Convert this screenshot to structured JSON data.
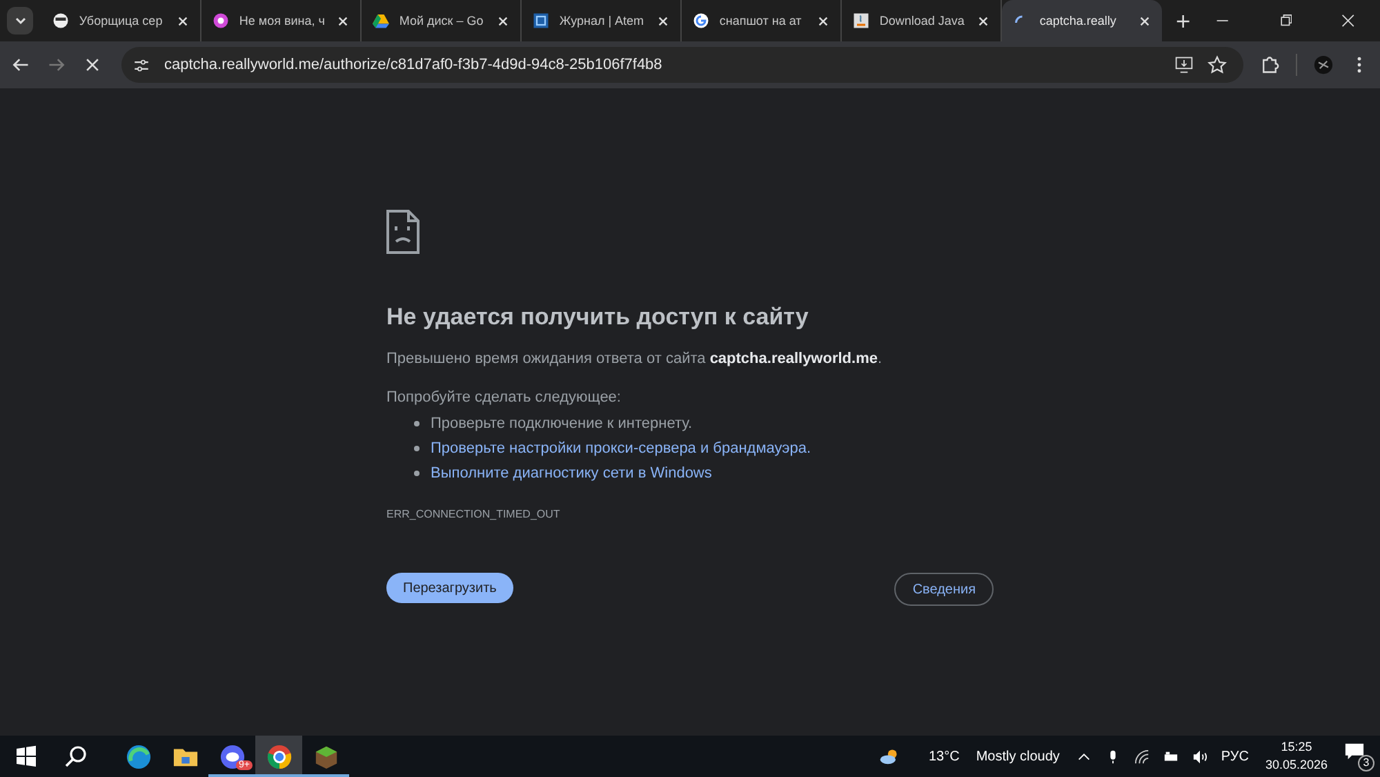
{
  "tabs": [
    {
      "title": "Уборщица сер",
      "kind": "face",
      "selected": false
    },
    {
      "title": "Не моя вина, ч",
      "kind": "flower",
      "selected": false
    },
    {
      "title": "Мой диск – Go",
      "kind": "drive",
      "selected": false
    },
    {
      "title": "Журнал | Atem",
      "kind": "square",
      "selected": false
    },
    {
      "title": "снапшот на ат",
      "kind": "google",
      "selected": false
    },
    {
      "title": "Download Java",
      "kind": "java",
      "selected": false
    },
    {
      "title": "captcha.really",
      "kind": "loading",
      "selected": true
    }
  ],
  "address_bar": {
    "url": "captcha.reallyworld.me/authorize/c81d7af0-f3b7-4d9d-94c8-25b106f7f4b8"
  },
  "error_page": {
    "heading": "Не удается получить доступ к сайту",
    "message": "Превышено время ожидания ответа от сайта **captcha.reallyworld.me**.",
    "suggestions_title": "Попробуйте сделать следующее:",
    "suggestions": [
      {
        "text": "Проверьте подключение к интернету.",
        "kind": "text"
      },
      {
        "text": "Проверьте настройки прокси-сервера и брандмауэра.",
        "kind": "link"
      },
      {
        "text": "Выполните диагностику сети в Windows",
        "kind": "link"
      }
    ],
    "error_code": "ERR_CONNECTION_TIMED_OUT",
    "reload_button": "Перезагрузить",
    "details_button": "Сведения"
  },
  "taskbar": {
    "apps": [
      {
        "kind": "edge",
        "selected": false,
        "running": false
      },
      {
        "kind": "folder",
        "selected": false,
        "running": false
      },
      {
        "kind": "discord",
        "selected": false,
        "running": true,
        "badge": "9+"
      },
      {
        "kind": "chrome",
        "selected": true,
        "running": true
      },
      {
        "kind": "minecraft",
        "selected": false,
        "running": true
      }
    ],
    "weather": {
      "temperature": "13°C",
      "condition": "Mostly cloudy"
    },
    "language": "РУС",
    "time": "15:25",
    "date": "30.05.2026",
    "notifications": "3"
  }
}
